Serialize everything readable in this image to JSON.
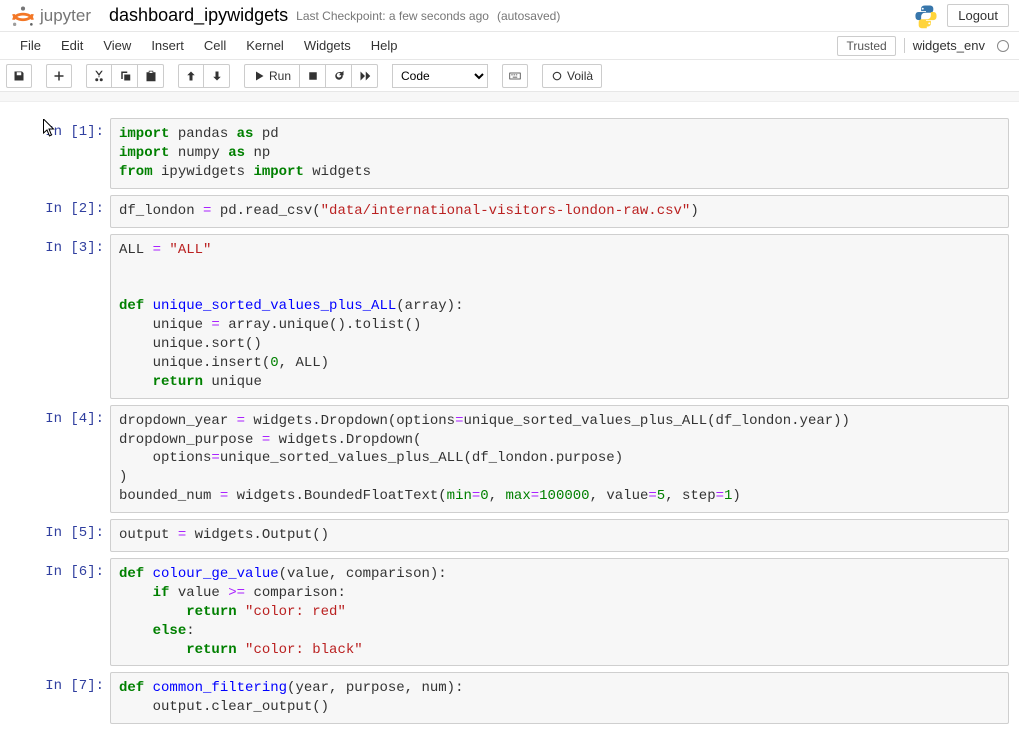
{
  "header": {
    "logo_text": "jupyter",
    "notebook_name": "dashboard_ipywidgets",
    "checkpoint": "Last Checkpoint: a few seconds ago",
    "autosave": "(autosaved)",
    "logout": "Logout"
  },
  "menu": {
    "items": [
      "File",
      "Edit",
      "View",
      "Insert",
      "Cell",
      "Kernel",
      "Widgets",
      "Help"
    ],
    "trusted": "Trusted",
    "kernel": "widgets_env"
  },
  "toolbar": {
    "run_label": "Run",
    "celltype": "Code",
    "voila": "Voilà"
  },
  "cells": [
    {
      "prompt": "In [1]:"
    },
    {
      "prompt": "In [2]:"
    },
    {
      "prompt": "In [3]:"
    },
    {
      "prompt": "In [4]:"
    },
    {
      "prompt": "In [5]:"
    },
    {
      "prompt": "In [6]:"
    },
    {
      "prompt": "In [7]:"
    }
  ],
  "code": {
    "c1": {
      "import": "import",
      "as": "as",
      "from": "from",
      "pandas": " pandas ",
      "pd": " pd",
      "numpy": " numpy ",
      "np": " np",
      "ipywidgets": " ipywidgets ",
      "widgets": " widgets"
    },
    "c2": {
      "lhs": "df_london ",
      "eq": "=",
      "mid": " pd.read_csv(",
      "str": "\"data/international-visitors-london-raw.csv\"",
      "tail": ")"
    },
    "c3": {
      "l1a": "ALL ",
      "eq": "=",
      "l1b": " ",
      "str": "\"ALL\"",
      "def": "def",
      "fname": " unique_sorted_values_plus_ALL",
      "sig": "(array):",
      "l3a": "    unique ",
      "l3b": " array.unique().tolist()",
      "l4": "    unique.sort()",
      "l5a": "    unique.insert(",
      "n0": "0",
      "l5b": ", ALL)",
      "return": "return",
      "l6": " unique"
    },
    "c4": {
      "l1a": "dropdown_year ",
      "eq": "=",
      "l1b": " widgets.Dropdown(options",
      "l1c": "unique_sorted_values_plus_ALL(df_london.year))",
      "l2a": "dropdown_purpose ",
      "l2b": " widgets.Dropdown(",
      "l3a": "    options",
      "l3b": "unique_sorted_values_plus_ALL(df_london.purpose)",
      "l4": ")",
      "l5a": "bounded_num ",
      "l5b": " widgets.BoundedFloatText(",
      "min": "min",
      "n0": "0",
      "comma": ", ",
      "max": "max",
      "n100000": "100000",
      "valuekw": ", value",
      "n5": "5",
      "stepkw": ", step",
      "n1": "1",
      "tail": ")"
    },
    "c5": {
      "l1a": "output ",
      "eq": "=",
      "l1b": " widgets.Output()"
    },
    "c6": {
      "def": "def",
      "fname": " colour_ge_value",
      "sig": "(value, comparison):",
      "if": "if",
      "l2": " value ",
      "ge": ">=",
      "l2b": " comparison:",
      "return": "return",
      "str_red": " \"color: red\"",
      "else": "else",
      "colon": ":",
      "str_black": " \"color: black\""
    },
    "c7": {
      "def": "def",
      "fname": " common_filtering",
      "sig": "(year, purpose, num):",
      "l2": "    output.clear_output()"
    }
  }
}
